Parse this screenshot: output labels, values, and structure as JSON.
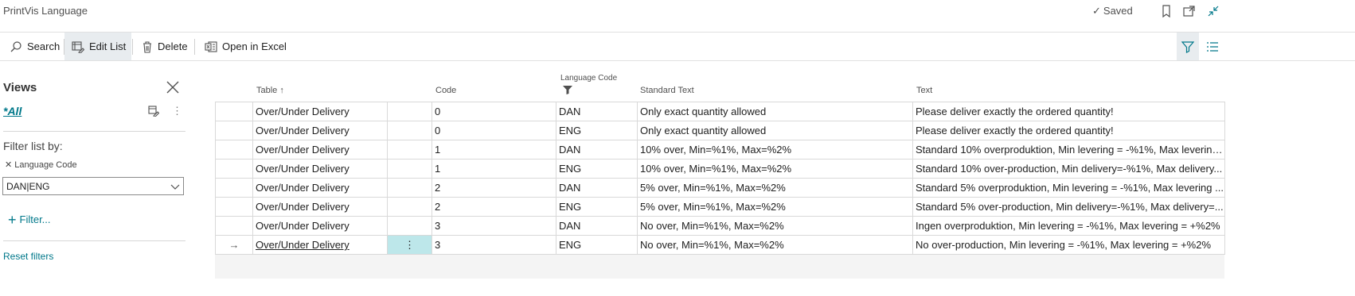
{
  "window": {
    "title": "PrintVis Language",
    "saved_label": "Saved"
  },
  "actions": {
    "search": "Search",
    "edit_list": "Edit List",
    "delete": "Delete",
    "open_excel": "Open in Excel"
  },
  "views": {
    "title": "Views",
    "all_label": "*All",
    "filter_list_by": "Filter list by:",
    "filter_field": "Language Code",
    "filter_value": "DAN|ENG",
    "add_filter": "Filter...",
    "reset_filters": "Reset filters"
  },
  "columns": {
    "table": "Table",
    "code": "Code",
    "language_code": "Language Code",
    "standard_text": "Standard Text",
    "text": "Text"
  },
  "rows": [
    {
      "table": "Over/Under Delivery",
      "code": "0",
      "lang": "DAN",
      "standard": "Only exact quantity allowed",
      "text": "Please deliver exactly the ordered quantity!"
    },
    {
      "table": "Over/Under Delivery",
      "code": "0",
      "lang": "ENG",
      "standard": "Only exact quantity allowed",
      "text": "Please deliver exactly the ordered quantity!"
    },
    {
      "table": "Over/Under Delivery",
      "code": "1",
      "lang": "DAN",
      "standard": "10% over, Min=%1%, Max=%2%",
      "text": "Standard 10% overproduktion, Min levering = -%1%, Max levering..."
    },
    {
      "table": "Over/Under Delivery",
      "code": "1",
      "lang": "ENG",
      "standard": "10% over, Min=%1%, Max=%2%",
      "text": "Standard 10% over-production, Min delivery=-%1%, Max delivery..."
    },
    {
      "table": "Over/Under Delivery",
      "code": "2",
      "lang": "DAN",
      "standard": "5% over, Min=%1%, Max=%2%",
      "text": "Standard 5% overproduktion, Min levering = -%1%, Max levering ..."
    },
    {
      "table": "Over/Under Delivery",
      "code": "2",
      "lang": "ENG",
      "standard": "5% over, Min=%1%, Max=%2%",
      "text": "Standard 5% over-production, Min delivery=-%1%, Max delivery=..."
    },
    {
      "table": "Over/Under Delivery",
      "code": "3",
      "lang": "DAN",
      "standard": "No over, Min=%1%, Max=%2%",
      "text": "Ingen overproduktion, Min levering = -%1%, Max levering = +%2%"
    },
    {
      "table": "Over/Under Delivery",
      "code": "3",
      "lang": "ENG",
      "standard": "No over, Min=%1%, Max=%2%",
      "text": "No over-production, Min levering = -%1%, Max levering = +%2%"
    }
  ]
}
